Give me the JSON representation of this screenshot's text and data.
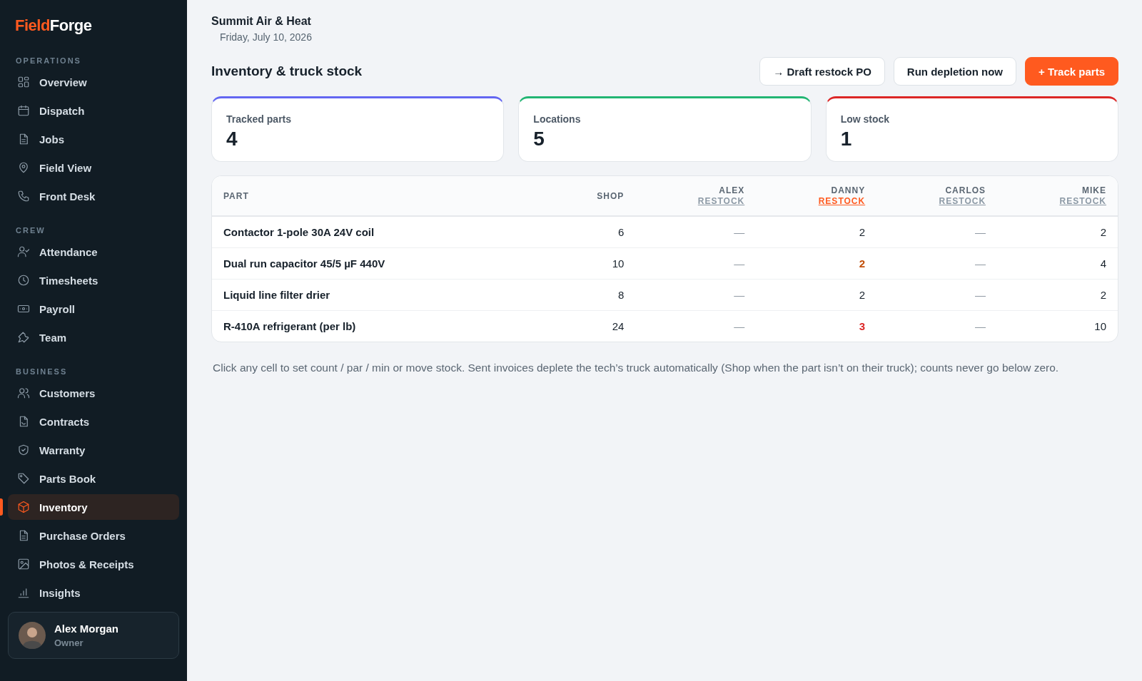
{
  "sidebar": {
    "logo": {
      "part_1": "Field",
      "part_2": "Forge"
    },
    "sections": [
      {
        "label": "OPERATIONS",
        "items": [
          {
            "label": "Overview",
            "selected": false
          },
          {
            "label": "Dispatch",
            "selected": false
          },
          {
            "label": "Jobs",
            "selected": false
          },
          {
            "label": "Field View",
            "selected": false
          },
          {
            "label": "Front Desk",
            "selected": false
          }
        ]
      },
      {
        "label": "CREW",
        "items": [
          {
            "label": "Attendance",
            "selected": false
          },
          {
            "label": "Timesheets",
            "selected": false
          },
          {
            "label": "Payroll",
            "selected": false
          },
          {
            "label": "Team",
            "selected": false
          }
        ]
      },
      {
        "label": "BUSINESS",
        "items": [
          {
            "label": "Customers",
            "selected": false
          },
          {
            "label": "Contracts",
            "selected": false
          },
          {
            "label": "Warranty",
            "selected": false
          },
          {
            "label": "Parts Book",
            "selected": false
          },
          {
            "label": "Inventory",
            "selected": true
          },
          {
            "label": "Purchase Orders",
            "selected": false
          },
          {
            "label": "Photos & Receipts",
            "selected": false
          },
          {
            "label": "Insights",
            "selected": false
          }
        ]
      }
    ],
    "user": {
      "name": "Alex Morgan",
      "role": "Owner"
    }
  },
  "header": {
    "company": "Summit Air & Heat",
    "date": "Friday, July 10, 2026"
  },
  "page": {
    "title": "Inventory & truck stock",
    "buttons": [
      {
        "label": "→ Draft restock PO",
        "kind": "secondary"
      },
      {
        "label": "Run depletion now",
        "kind": "secondary"
      },
      {
        "label": "+ Track parts",
        "kind": "primary"
      }
    ]
  },
  "stats": [
    {
      "label": "Tracked parts",
      "value": "4",
      "color": "#6366f1"
    },
    {
      "label": "Locations",
      "value": "5",
      "color": "#22b573"
    },
    {
      "label": "Low stock",
      "value": "1",
      "color": "#dc2626"
    }
  ],
  "table": {
    "columns": [
      {
        "label": "PART",
        "kind": "part"
      },
      {
        "label": "SHOP",
        "kind": "plain"
      },
      {
        "label": "ALEX",
        "link": "RESTOCK",
        "alert": false,
        "kind": "truck"
      },
      {
        "label": "DANNY",
        "link": "RESTOCK",
        "alert": true,
        "kind": "truck"
      },
      {
        "label": "CARLOS",
        "link": "RESTOCK",
        "alert": false,
        "kind": "truck"
      },
      {
        "label": "MIKE",
        "link": "RESTOCK",
        "alert": false,
        "kind": "truck"
      }
    ],
    "rows": [
      {
        "cells": [
          {
            "text": "Contactor 1-pole 30A 24V coil",
            "kind": "part"
          },
          {
            "text": "6",
            "kind": "ok"
          },
          {
            "text": "—",
            "kind": "empty"
          },
          {
            "text": "2",
            "kind": "ok"
          },
          {
            "text": "—",
            "kind": "empty"
          },
          {
            "text": "2",
            "kind": "ok"
          }
        ]
      },
      {
        "cells": [
          {
            "text": "Dual run capacitor 45/5 µF 440V",
            "kind": "part"
          },
          {
            "text": "10",
            "kind": "ok"
          },
          {
            "text": "—",
            "kind": "empty"
          },
          {
            "text": "2",
            "kind": "warn"
          },
          {
            "text": "—",
            "kind": "empty"
          },
          {
            "text": "4",
            "kind": "ok"
          }
        ]
      },
      {
        "cells": [
          {
            "text": "Liquid line filter drier",
            "kind": "part"
          },
          {
            "text": "8",
            "kind": "ok"
          },
          {
            "text": "—",
            "kind": "empty"
          },
          {
            "text": "2",
            "kind": "ok"
          },
          {
            "text": "—",
            "kind": "empty"
          },
          {
            "text": "2",
            "kind": "ok"
          }
        ]
      },
      {
        "cells": [
          {
            "text": "R-410A refrigerant (per lb)",
            "kind": "part"
          },
          {
            "text": "24",
            "kind": "ok"
          },
          {
            "text": "—",
            "kind": "empty"
          },
          {
            "text": "3",
            "kind": "low"
          },
          {
            "text": "—",
            "kind": "empty"
          },
          {
            "text": "10",
            "kind": "ok"
          }
        ]
      }
    ]
  },
  "note": "Click any cell to set count / par / min or move stock. Sent invoices deplete the tech’s truck automatically (Shop when the part isn’t on their truck); counts never go below zero."
}
